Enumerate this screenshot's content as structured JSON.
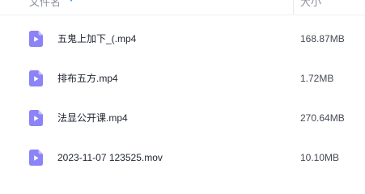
{
  "header": {
    "name_label": "文件名",
    "size_label": "大小",
    "sort_icon": "sort-down-icon",
    "accent_color": "#2b8cf5"
  },
  "files": [
    {
      "name": "五鬼上加下_(.mp4",
      "size": "168.87MB",
      "icon": "video-file-icon"
    },
    {
      "name": "排布五方.mp4",
      "size": "1.72MB",
      "icon": "video-file-icon"
    },
    {
      "name": "法显公开课.mp4",
      "size": "270.64MB",
      "icon": "video-file-icon"
    },
    {
      "name": "2023-11-07 123525.mov",
      "size": "10.10MB",
      "icon": "video-file-icon"
    }
  ],
  "colors": {
    "icon_body": "#8b83f7",
    "icon_fold": "#c5c0fb",
    "icon_play": "#ffffff"
  }
}
